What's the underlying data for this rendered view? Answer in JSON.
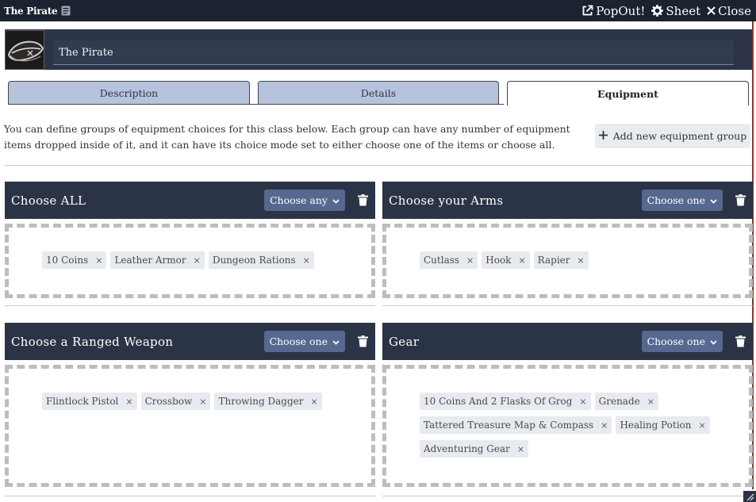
{
  "window": {
    "title": "The Pirate",
    "popout_label": "PopOut!",
    "sheet_label": "Sheet",
    "close_label": "Close"
  },
  "header": {
    "name_value": "The Pirate"
  },
  "tabs": [
    {
      "label": "Description",
      "active": false
    },
    {
      "label": "Details",
      "active": false
    },
    {
      "label": "Equipment",
      "active": true
    }
  ],
  "intro_text": "You can define groups of equipment choices for this class below. Each group can have any number of equipment items dropped inside of it, and it can have its choice mode set to either choose one of the items or choose all.",
  "add_group_label": "Add new equipment group",
  "groups": [
    {
      "title": "Choose ALL",
      "mode": "Choose any",
      "items": [
        "10 Coins",
        "Leather Armor",
        "Dungeon Rations"
      ]
    },
    {
      "title": "Choose your Arms",
      "mode": "Choose one",
      "items": [
        "Cutlass",
        "Hook",
        "Rapier"
      ]
    },
    {
      "title": "Choose a Ranged Weapon",
      "mode": "Choose one",
      "items": [
        "Flintlock Pistol",
        "Crossbow",
        "Throwing Dagger"
      ]
    },
    {
      "title": "Gear",
      "mode": "Choose one",
      "items": [
        "10 Coins And 2 Flasks Of Grog",
        "Grenade",
        "Tattered Treasure Map & Compass",
        "Healing Potion",
        "Adventuring Gear"
      ]
    }
  ],
  "colors": {
    "titlebar": "#1c2330",
    "panel_header": "#2b3446",
    "select": "#56688f",
    "tab_inactive": "#b6c3dd",
    "chip": "#e7ebef",
    "accent_edge": "#8a3a24"
  },
  "icons": [
    "id-card-icon",
    "external-link-icon",
    "gear-icon",
    "close-icon",
    "plus-icon",
    "chevron-down-icon",
    "trash-icon",
    "remove-icon",
    "resize-icon"
  ]
}
